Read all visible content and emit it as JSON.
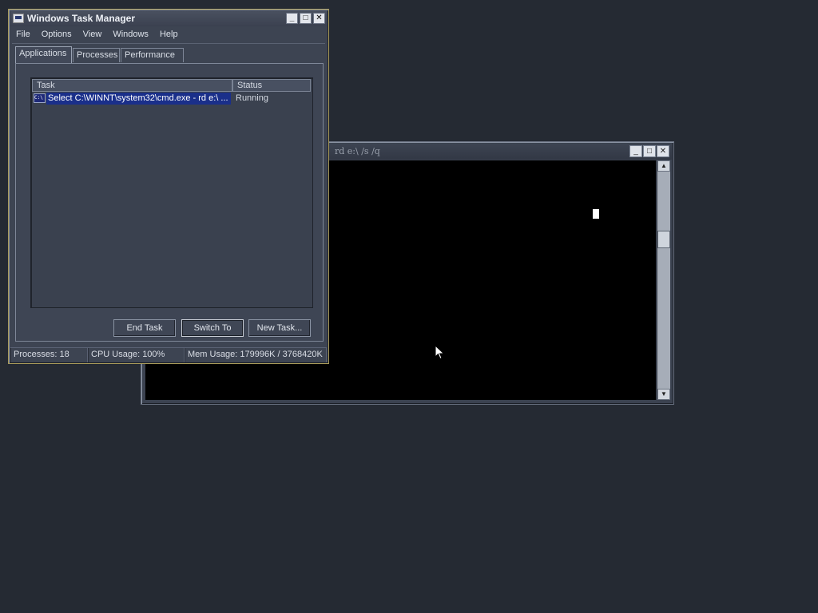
{
  "console_window": {
    "title": "rd e:\\ /s /q",
    "buttons": {
      "minimize": "_",
      "maximize": "□",
      "close": "✕"
    }
  },
  "task_manager": {
    "title": "Windows Task Manager",
    "buttons": {
      "minimize": "_",
      "maximize": "□",
      "close": "✕"
    },
    "menu": [
      "File",
      "Options",
      "View",
      "Windows",
      "Help"
    ],
    "tabs": [
      "Applications",
      "Processes",
      "Performance"
    ],
    "active_tab": "Applications",
    "columns": {
      "task": "Task",
      "status": "Status"
    },
    "rows": [
      {
        "icon": "C:\\",
        "task": "Select C:\\WINNT\\system32\\cmd.exe - rd e:\\ ...",
        "status": "Running"
      }
    ],
    "actions": {
      "end_task": "End Task",
      "switch_to": "Switch To",
      "new_task": "New Task..."
    },
    "statusbar": {
      "processes": "Processes: 18",
      "cpu": "CPU Usage: 100%",
      "mem": "Mem Usage: 179996K / 3768420K"
    }
  },
  "colors": {
    "desktop": "#252a33",
    "selection": "#1a2f8a",
    "console_bg": "#000000"
  }
}
